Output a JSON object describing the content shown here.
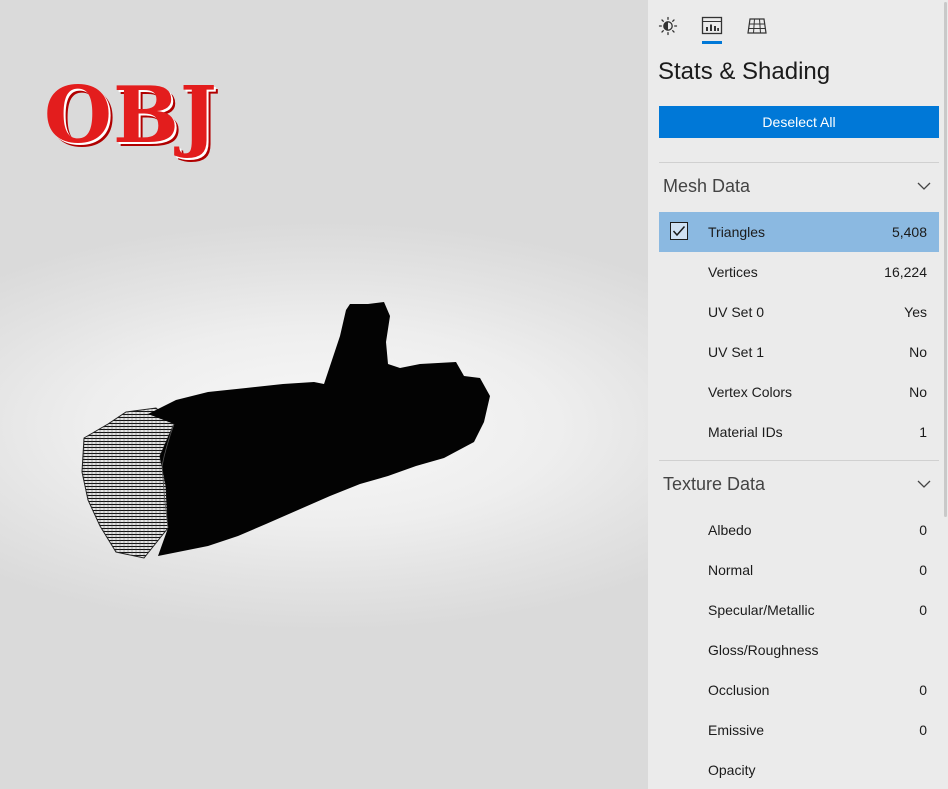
{
  "viewport": {
    "logo_text": "OBJ"
  },
  "panel": {
    "tabs": [
      {
        "name": "lighting",
        "icon": "sun-icon"
      },
      {
        "name": "stats",
        "icon": "stats-icon",
        "active": true
      },
      {
        "name": "grid",
        "icon": "grid-icon"
      }
    ],
    "title": "Stats & Shading",
    "deselect_label": "Deselect All",
    "mesh_section": {
      "title": "Mesh Data",
      "rows": [
        {
          "label": "Triangles",
          "value": "5,408",
          "selected": true
        },
        {
          "label": "Vertices",
          "value": "16,224"
        },
        {
          "label": "UV Set 0",
          "value": "Yes"
        },
        {
          "label": "UV Set 1",
          "value": "No"
        },
        {
          "label": "Vertex Colors",
          "value": "No"
        },
        {
          "label": "Material IDs",
          "value": "1"
        }
      ]
    },
    "texture_section": {
      "title": "Texture Data",
      "rows": [
        {
          "label": "Albedo",
          "value": "0"
        },
        {
          "label": "Normal",
          "value": "0"
        },
        {
          "label": "Specular/Metallic",
          "value": "0"
        },
        {
          "label": "Gloss/Roughness",
          "value": ""
        },
        {
          "label": "Occlusion",
          "value": "0"
        },
        {
          "label": "Emissive",
          "value": "0"
        },
        {
          "label": "Opacity",
          "value": ""
        }
      ]
    }
  },
  "colors": {
    "accent": "#0078d7",
    "selected_row": "#8bb9e1",
    "logo_red": "#e31d1d"
  }
}
